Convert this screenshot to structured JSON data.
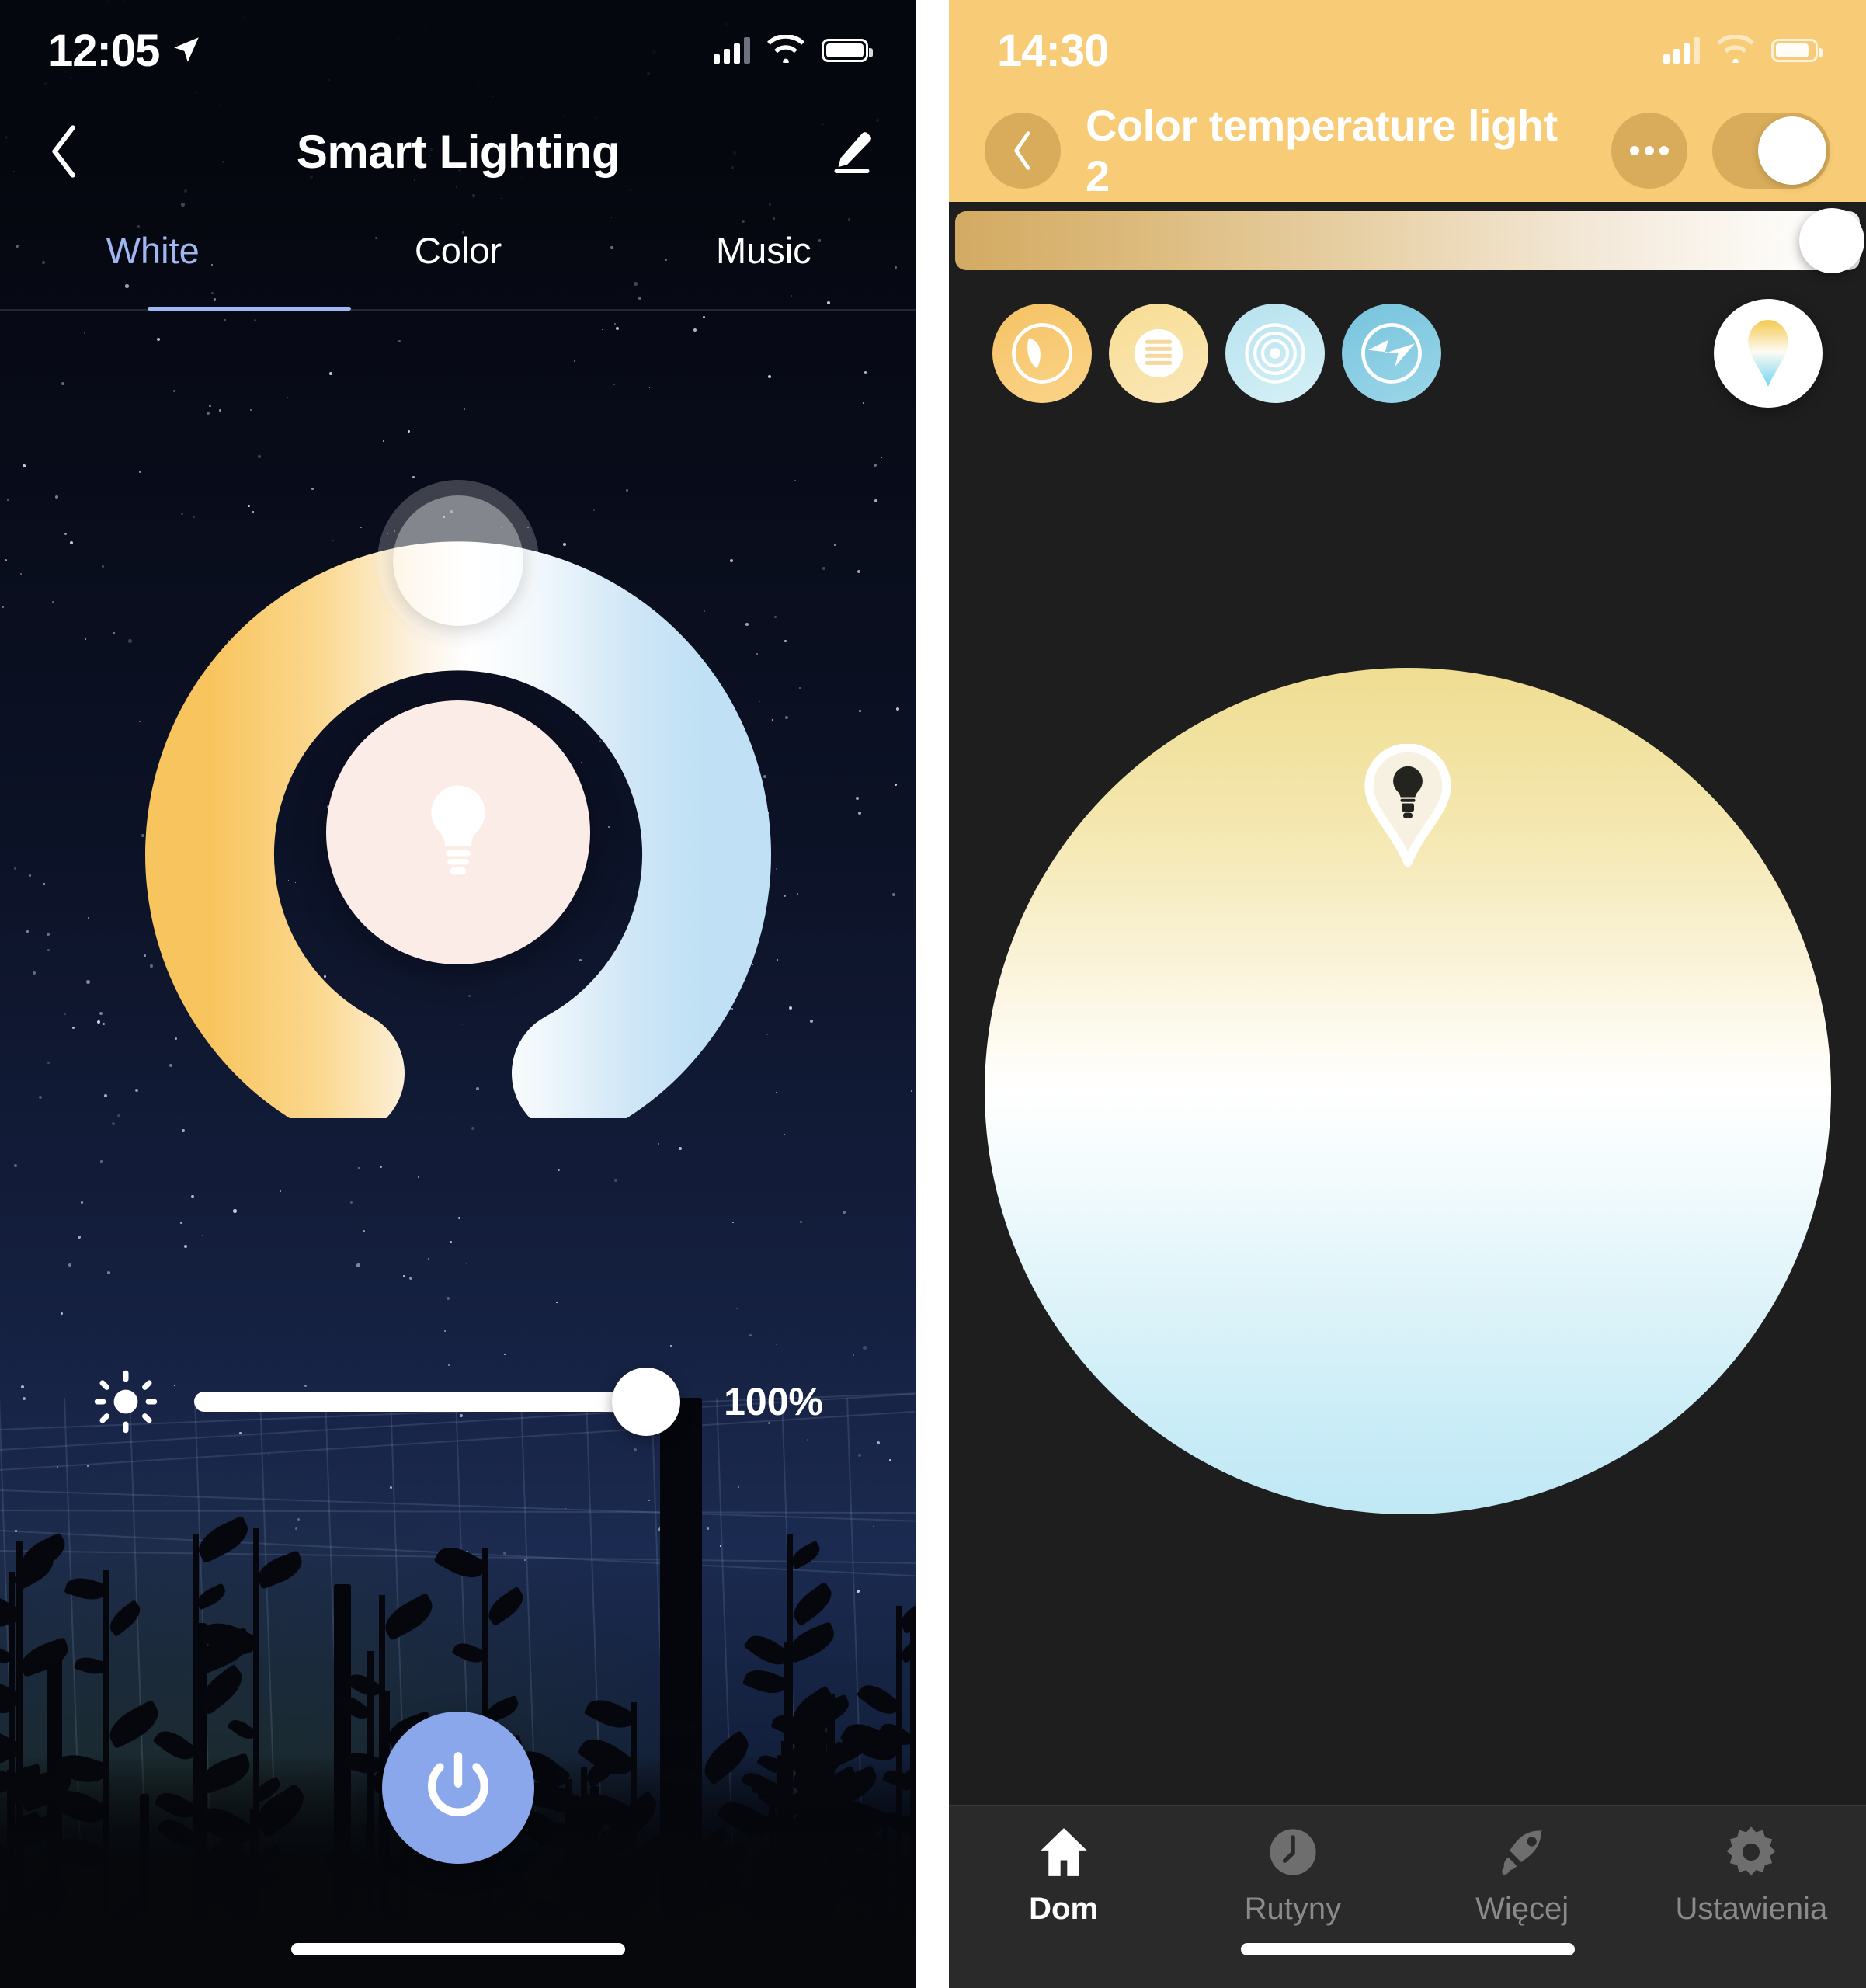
{
  "left_screen": {
    "status_bar": {
      "time": "12:05",
      "location_icon": "location-arrow-icon",
      "signal_icon": "cellular-signal-icon",
      "wifi_icon": "wifi-icon",
      "battery_icon": "battery-icon"
    },
    "nav": {
      "back_icon": "chevron-left-icon",
      "title": "Smart Lighting",
      "edit_icon": "pencil-edit-icon"
    },
    "tabs": [
      {
        "label": "White",
        "active": true
      },
      {
        "label": "Color",
        "active": false
      },
      {
        "label": "Music",
        "active": false
      }
    ],
    "dial": {
      "name": "color-temperature-dial",
      "center_icon": "light-bulb-icon",
      "warm_color": "#f8c45e",
      "neutral_color": "#ffffff",
      "cool_color": "#bfe0f5",
      "center_bg": "#fcece7"
    },
    "brightness": {
      "icon": "brightness-sun-icon",
      "value": "100%",
      "percent": 100
    },
    "power_button": {
      "icon": "power-icon",
      "color": "#8ba7ec"
    }
  },
  "right_screen": {
    "status_bar": {
      "time": "14:30",
      "signal_icon": "cellular-signal-icon",
      "wifi_icon": "wifi-icon",
      "battery_icon": "battery-icon"
    },
    "header": {
      "back_icon": "chevron-left-icon",
      "title": "Color temperature light 2",
      "more_icon": "more-options-icon",
      "toggle_state": "on",
      "bg_color": "#f8cb76"
    },
    "temperature_slider": {
      "name": "color-temperature-slider",
      "percent": 100
    },
    "scenes": [
      {
        "name": "scene-night",
        "icon": "moon-icon"
      },
      {
        "name": "scene-reading",
        "icon": "reading-lines-icon"
      },
      {
        "name": "scene-relax",
        "icon": "concentric-rings-icon"
      },
      {
        "name": "scene-energize",
        "icon": "lightning-bolt-icon"
      }
    ],
    "picker_button": {
      "name": "color-temperature-picker",
      "icon": "gradient-drop-icon"
    },
    "color_circle": {
      "name": "color-temperature-wheel",
      "top_color": "#efdd92",
      "mid_color": "#ffffff",
      "bottom_color": "#bfe8f5",
      "pin_icon": "light-bulb-pin-icon"
    },
    "tabbar": [
      {
        "label": "Dom",
        "icon": "home-icon",
        "active": true
      },
      {
        "label": "Rutyny",
        "icon": "clock-icon",
        "active": false
      },
      {
        "label": "Więcej",
        "icon": "rocket-icon",
        "active": false
      },
      {
        "label": "Ustawienia",
        "icon": "gear-icon",
        "active": false
      }
    ]
  }
}
